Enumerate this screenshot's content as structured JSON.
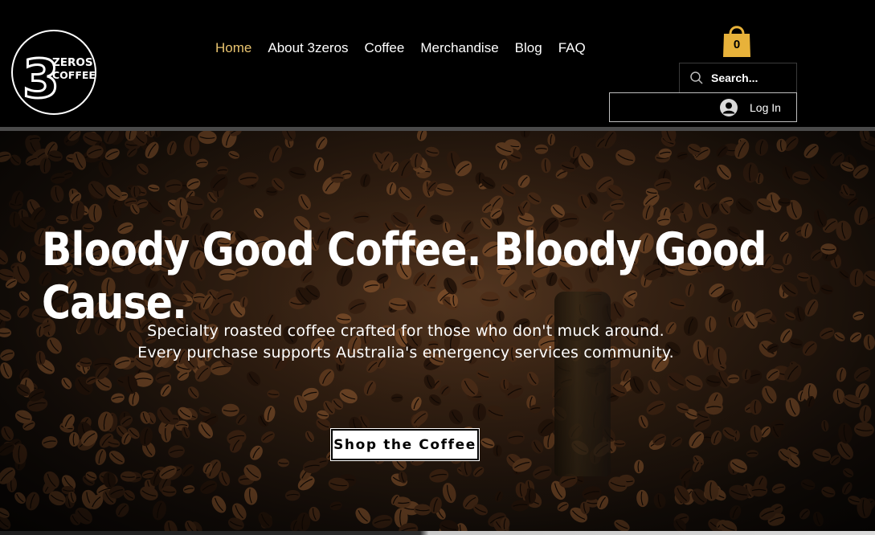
{
  "brand": {
    "logo_number": "3",
    "logo_line1": "ZEROS",
    "logo_line2": "COFFEE"
  },
  "nav": {
    "items": [
      {
        "label": "Home",
        "active": true
      },
      {
        "label": "About 3zeros",
        "active": false
      },
      {
        "label": "Coffee",
        "active": false
      },
      {
        "label": "Merchandise",
        "active": false
      },
      {
        "label": "Blog",
        "active": false
      },
      {
        "label": "FAQ",
        "active": false
      }
    ]
  },
  "cart": {
    "count": "0",
    "icon": "shopping-bag-icon",
    "color": "#e8b23a"
  },
  "search": {
    "placeholder": "Search...",
    "value": ""
  },
  "login": {
    "label": "Log In",
    "icon": "avatar-icon"
  },
  "hero": {
    "title": "Bloody Good Coffee. Bloody Good Cause.",
    "subtitle_line1": "Specialty roasted coffee crafted for those who don't muck around.",
    "subtitle_line2": "Every purchase supports Australia's emergency services community.",
    "cta_label": "Shop the Coffee"
  },
  "colors": {
    "accent": "#e8c36f",
    "background": "#000000"
  }
}
